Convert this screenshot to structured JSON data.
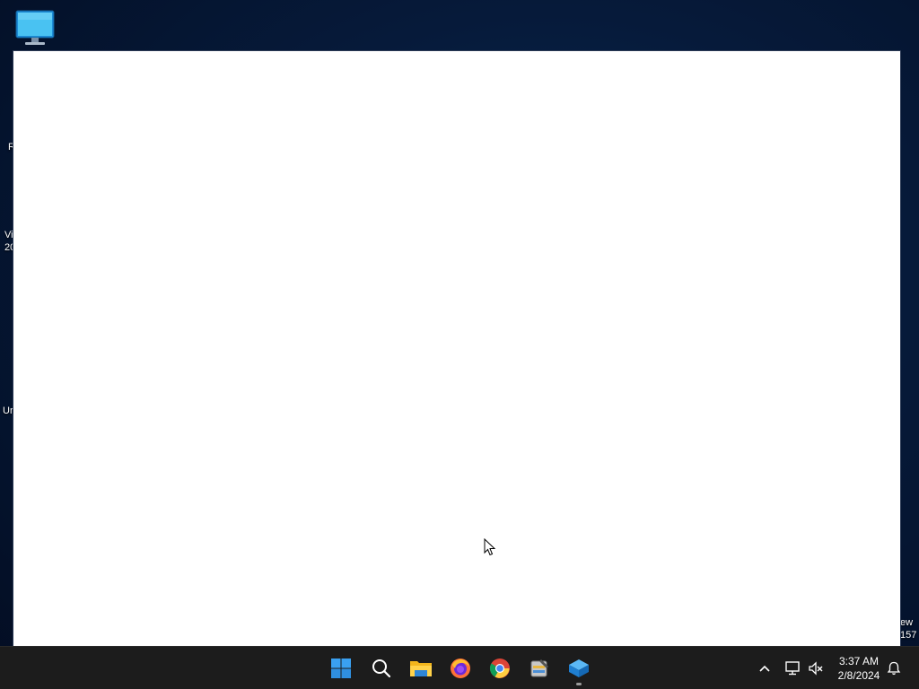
{
  "desktop": {
    "icons": [
      {
        "name": "this-pc",
        "icon": "monitor-icon"
      }
    ],
    "partial_labels": {
      "left_1": "R",
      "left_2": "Vi\n20",
      "left_3": "Ur",
      "right_1": "ew\n157"
    }
  },
  "window": {
    "background": "#ffffff"
  },
  "taskbar": {
    "pinned": [
      {
        "name": "start-button",
        "icon": "windows-logo-icon"
      },
      {
        "name": "search-button",
        "icon": "search-icon"
      },
      {
        "name": "file-explorer",
        "icon": "folder-icon"
      },
      {
        "name": "firefox",
        "icon": "firefox-icon"
      },
      {
        "name": "chrome",
        "icon": "chrome-icon"
      },
      {
        "name": "setup-tool",
        "icon": "install-tool-icon"
      },
      {
        "name": "virtualbox-app",
        "icon": "cube-app-icon",
        "running": true
      }
    ],
    "tray": {
      "icons": [
        "chevron-up-icon",
        "network-icon",
        "volume-muted-icon",
        "notification-icon"
      ],
      "time": "3:37 AM",
      "date": "2/8/2024"
    }
  },
  "colors": {
    "taskbar_bg": "#1c1c1c",
    "accent": "#0a84ff"
  }
}
